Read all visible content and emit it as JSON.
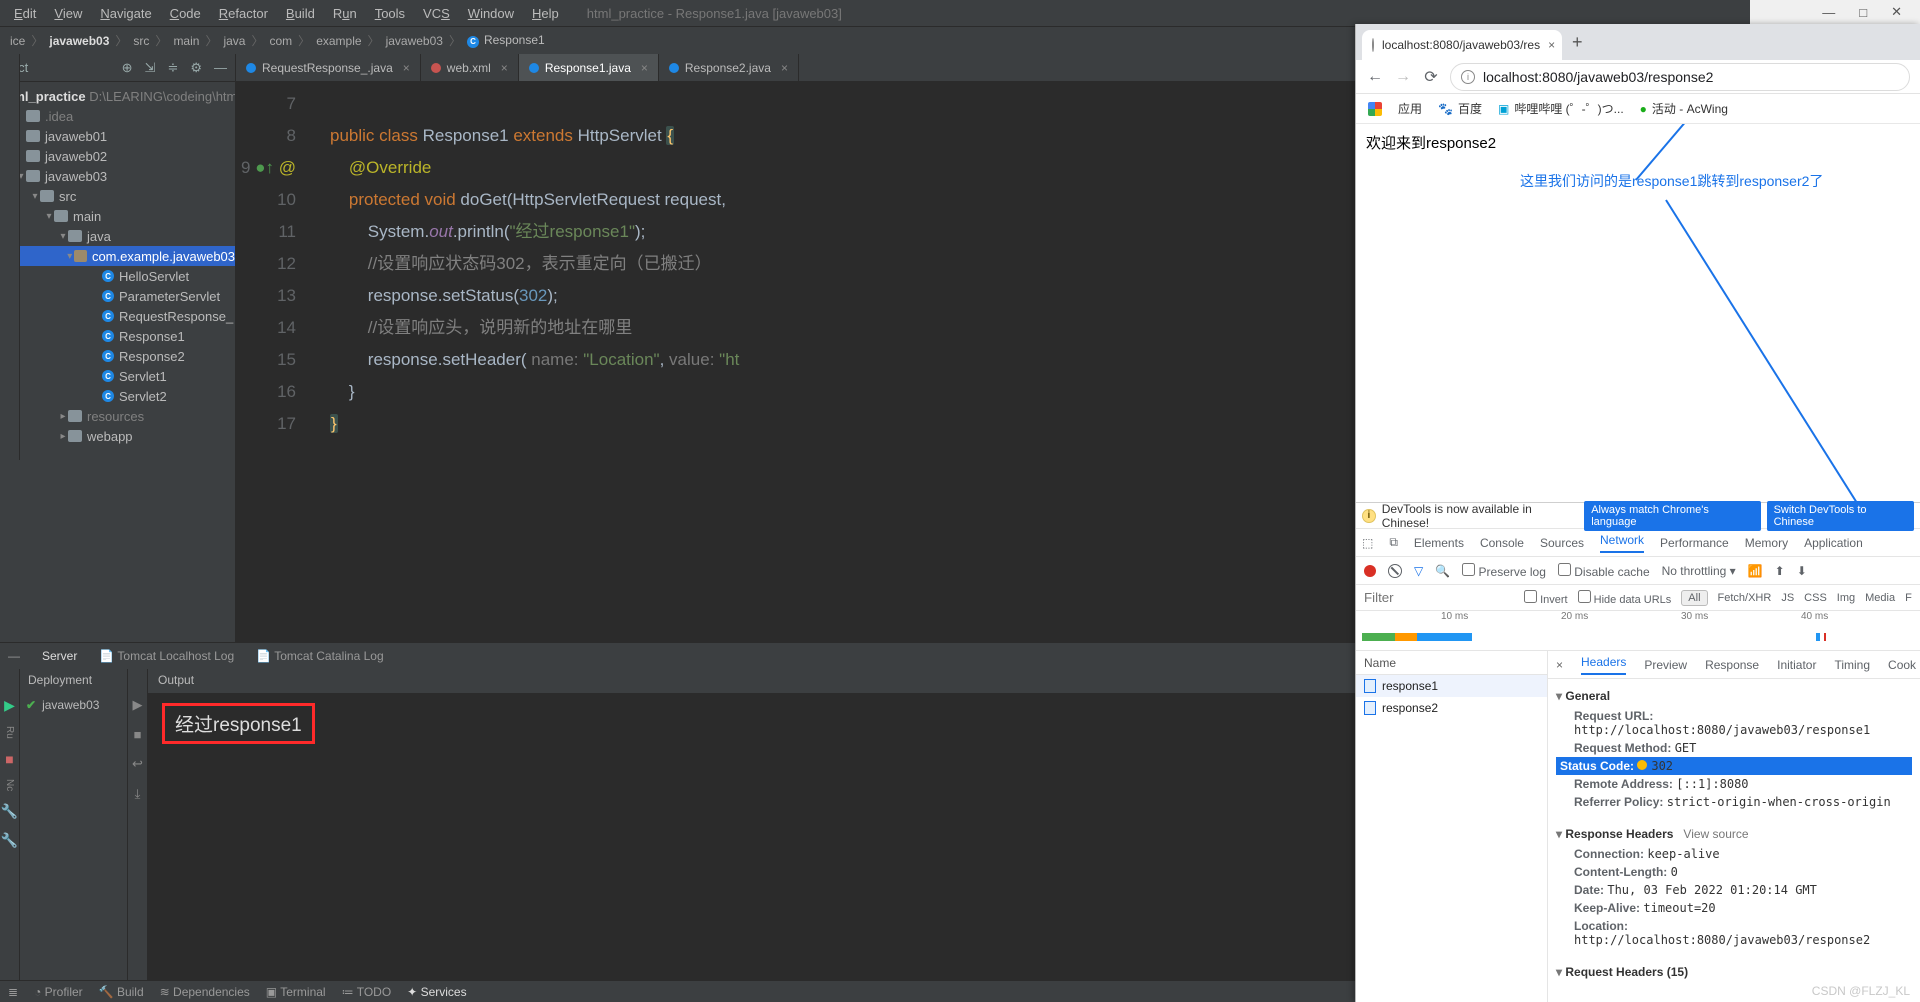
{
  "menu": {
    "items": [
      "Edit",
      "View",
      "Navigate",
      "Code",
      "Refactor",
      "Build",
      "Run",
      "Tools",
      "VCS",
      "Window",
      "Help"
    ],
    "title": "html_practice - Response1.java [javaweb03]"
  },
  "winbtns": {
    "min": "—",
    "max": "□",
    "close": "✕"
  },
  "crumbs": [
    "ice",
    "javaweb03",
    "src",
    "main",
    "java",
    "com",
    "example",
    "javaweb03",
    "Response1"
  ],
  "projHeader": {
    "label": "ject"
  },
  "tree": {
    "root": {
      "name": "tml_practice",
      "path": "D:\\LEARING\\codeing\\html_"
    },
    "rows": [
      {
        "ind": 12,
        "exp": "",
        "ic": "fld",
        "text": ".idea",
        "dim": true
      },
      {
        "ind": 12,
        "exp": "",
        "ic": "fld",
        "text": "javaweb01"
      },
      {
        "ind": 12,
        "exp": "",
        "ic": "fld",
        "text": "javaweb02"
      },
      {
        "ind": 12,
        "exp": "▾",
        "ic": "fld",
        "text": "javaweb03"
      },
      {
        "ind": 26,
        "exp": "▾",
        "ic": "fld",
        "text": "src"
      },
      {
        "ind": 40,
        "exp": "▾",
        "ic": "fld",
        "text": "main"
      },
      {
        "ind": 54,
        "exp": "▾",
        "ic": "fld",
        "text": "java"
      },
      {
        "ind": 68,
        "exp": "▾",
        "ic": "pkg",
        "text": "com.example.javaweb03",
        "sel": true
      },
      {
        "ind": 88,
        "exp": "",
        "ic": "cls",
        "text": "HelloServlet"
      },
      {
        "ind": 88,
        "exp": "",
        "ic": "cls",
        "text": "ParameterServlet"
      },
      {
        "ind": 88,
        "exp": "",
        "ic": "cls",
        "text": "RequestResponse_"
      },
      {
        "ind": 88,
        "exp": "",
        "ic": "cls",
        "text": "Response1"
      },
      {
        "ind": 88,
        "exp": "",
        "ic": "cls",
        "text": "Response2"
      },
      {
        "ind": 88,
        "exp": "",
        "ic": "cls",
        "text": "Servlet1"
      },
      {
        "ind": 88,
        "exp": "",
        "ic": "cls",
        "text": "Servlet2"
      },
      {
        "ind": 54,
        "exp": "▸",
        "ic": "fld",
        "text": "resources",
        "dim": true
      },
      {
        "ind": 54,
        "exp": "▸",
        "ic": "fld",
        "text": "webapp"
      }
    ]
  },
  "tabs": [
    {
      "name": "RequestResponse_.java",
      "type": "cls"
    },
    {
      "name": "web.xml",
      "type": "xml"
    },
    {
      "name": "Response1.java",
      "type": "cls",
      "active": true
    },
    {
      "name": "Response2.java",
      "type": "cls"
    }
  ],
  "code": {
    "lines": [
      7,
      8,
      9,
      10,
      11,
      12,
      13,
      14,
      15,
      16,
      17
    ],
    "l7": "public class Response1 extends HttpServlet {",
    "l8": "    @Override",
    "l9": "    protected void doGet(HttpServletRequest request,",
    "l10": "        System.out.println(\"经过response1\");",
    "l11": "        //设置响应状态码302，表示重定向（已搬迁）",
    "l12": "        response.setStatus(302);",
    "l13": "        //设置响应头，说明新的地址在哪里",
    "l14a": "        response.setHeader( ",
    "l14name": "name: ",
    "l14loc": "\"Location\"",
    "l14c": ", ",
    "l14val": "value: ",
    "l14h": "\"ht",
    "l15": "    }",
    "l16": "}"
  },
  "bottomTabs": {
    "server": "Server",
    "tclog": "Tomcat Localhost Log",
    "tcat": "Tomcat Catalina Log"
  },
  "dep": {
    "deployment": "Deployment",
    "item": "javaweb03"
  },
  "output": {
    "label": "Output",
    "text": "经过response1"
  },
  "status": {
    "profiler": "Profiler",
    "build": "Build",
    "dep": "Dependencies",
    "term": "Terminal",
    "todo": "TODO",
    "svc": "Services"
  },
  "lefttool": {
    "dbg": "▶",
    "run": "Ru",
    "nc": "Nc"
  },
  "browser": {
    "tab": "localhost:8080/javaweb03/res",
    "url": "localhost:8080/javaweb03/response2",
    "bookmarks": {
      "apps": "应用",
      "baidu": "百度",
      "bilibili": "哔哩哔哩 (゜-゜)つ...",
      "acwing": "活动 - AcWing"
    },
    "pageText": "欢迎来到response2",
    "note": "这里我们访问的是response1跳转到responser2了"
  },
  "devtools": {
    "banner": {
      "text": "DevTools is now available in Chinese!",
      "b1": "Always match Chrome's language",
      "b2": "Switch DevTools to Chinese"
    },
    "tabs": [
      "Elements",
      "Console",
      "Sources",
      "Network",
      "Performance",
      "Memory",
      "Application"
    ],
    "tools": {
      "preserve": "Preserve log",
      "disable": "Disable cache",
      "throttle": "No throttling"
    },
    "filter": {
      "ph": "Filter",
      "invert": "Invert",
      "hide": "Hide data URLs",
      "all": "All",
      "fx": "Fetch/XHR",
      "js": "JS",
      "css": "CSS",
      "img": "Img",
      "media": "Media",
      "f": "F"
    },
    "times": [
      "10 ms",
      "20 ms",
      "30 ms",
      "40 ms"
    ],
    "list": {
      "name": "Name",
      "r1": "response1",
      "r2": "response2"
    },
    "detailTabs": [
      "Headers",
      "Preview",
      "Response",
      "Initiator",
      "Timing",
      "Cook"
    ],
    "general": {
      "title": "General",
      "url_k": "Request URL:",
      "url_v": "http://localhost:8080/javaweb03/response1",
      "method_k": "Request Method:",
      "method_v": "GET",
      "status_k": "Status Code:",
      "status_v": "302",
      "remote_k": "Remote Address:",
      "remote_v": "[::1]:8080",
      "ref_k": "Referrer Policy:",
      "ref_v": "strict-origin-when-cross-origin"
    },
    "resp": {
      "title": "Response Headers",
      "viewsrc": "View source",
      "conn_k": "Connection:",
      "conn_v": "keep-alive",
      "len_k": "Content-Length:",
      "len_v": "0",
      "date_k": "Date:",
      "date_v": "Thu, 03 Feb 2022 01:20:14 GMT",
      "ka_k": "Keep-Alive:",
      "ka_v": "timeout=20",
      "loc_k": "Location:",
      "loc_v": "http://localhost:8080/javaweb03/response2"
    },
    "reqh": "Request Headers (15)"
  },
  "watermark": "CSDN @FLZJ_KL"
}
